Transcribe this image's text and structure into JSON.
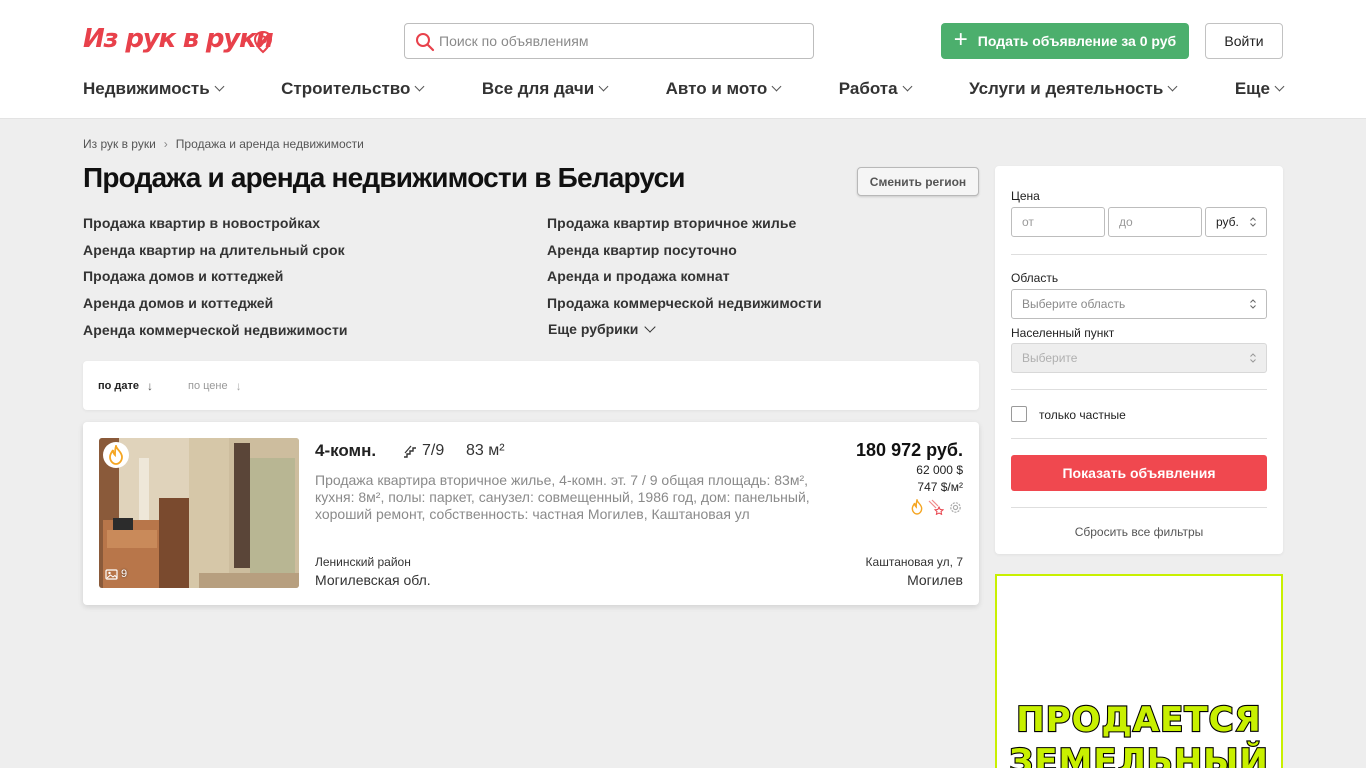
{
  "header": {
    "logo": "Из рук в руки",
    "search_placeholder": "Поиск по объявлениям",
    "post_button": "Подать объявление за 0 руб",
    "login_button": "Войти"
  },
  "nav": [
    "Недвижимость",
    "Строительство",
    "Все для дачи",
    "Авто и мото",
    "Работа",
    "Услуги и деятельность",
    "Еще"
  ],
  "breadcrumb": [
    "Из рук в руки",
    "Продажа и аренда недвижимости"
  ],
  "page_title": "Продажа и аренда недвижимости в Беларуси",
  "region_button": "Сменить регион",
  "categories": [
    "Продажа квартир в новостройках",
    "Продажа квартир вторичное жилье",
    "Аренда квартир на длительный срок",
    "Аренда квартир посуточно",
    "Продажа домов и коттеджей",
    "Аренда и продажа комнат",
    "Аренда домов и коттеджей",
    "Продажа коммерческой недвижимости",
    "Аренда коммерческой недвижимости"
  ],
  "more_rubrics": "Еще рубрики",
  "sort": {
    "by_date": "по дате",
    "by_price": "по цене"
  },
  "listing": {
    "photo_count": "9",
    "rooms": "4-комн.",
    "floor": "7/9",
    "area": "83 м²",
    "description": "Продажа квартира вторичное жилье, 4-комн. эт. 7 / 9 общая площадь: 83м², кухня: 8м², полы: паркет, санузел: совмещенный, 1986 год, дом: панельный, хороший ремонт, собственность: частная Могилев, Каштановая ул",
    "price": "180 972 руб.",
    "price_usd": "62 000 $",
    "price_per_m2": "747 $/м²",
    "district": "Ленинский район",
    "oblast": "Могилевская обл.",
    "street": "Каштановая ул, 7",
    "city": "Могилев"
  },
  "filters": {
    "price_label": "Цена",
    "from_placeholder": "от",
    "to_placeholder": "до",
    "currency": "руб.",
    "region_label": "Область",
    "region_placeholder": "Выберите область",
    "locality_label": "Населенный пункт",
    "locality_placeholder": "Выберите",
    "private_only": "только частные",
    "show_button": "Показать объявления",
    "reset": "Сбросить все фильтры"
  },
  "ad": {
    "line1": "ПРОДАЕТСЯ",
    "line2": "ЗЕМЕЛЬНЫЙ"
  },
  "colors": {
    "brand_red": "#e8414b",
    "green": "#4caf6d",
    "show_button": "#f0484f",
    "ad_lime": "#c8f000"
  }
}
